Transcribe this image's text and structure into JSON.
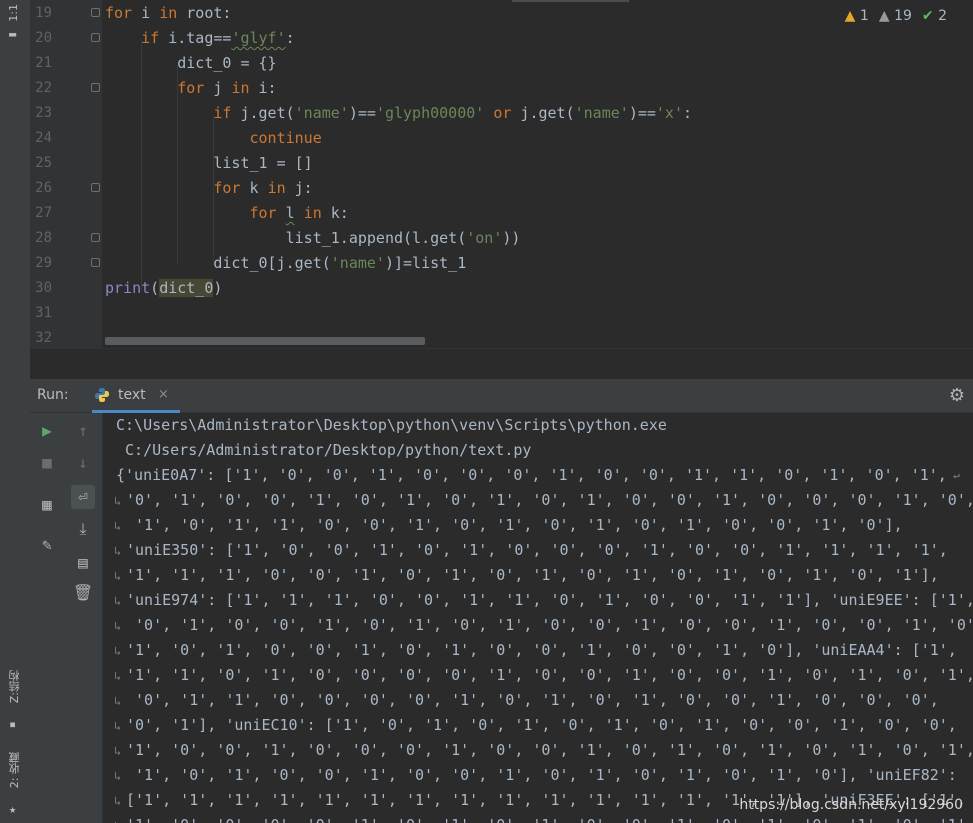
{
  "sidebar": {
    "top_label": "1:1",
    "structure_label": "Z:结构",
    "favorites_label": "2: 收藏"
  },
  "inspections": {
    "warnings": "1",
    "weak_warnings": "19",
    "typos": "2"
  },
  "editor": {
    "lines": [
      {
        "num": "19",
        "text": "for i in root:"
      },
      {
        "num": "20",
        "text": "    if i.tag=='glyf':"
      },
      {
        "num": "21",
        "text": "        dict_0 = {}"
      },
      {
        "num": "22",
        "text": "        for j in i:"
      },
      {
        "num": "23",
        "text": "            if j.get('name')=='glyph00000' or j.get('name')=='x':"
      },
      {
        "num": "24",
        "text": "                continue"
      },
      {
        "num": "25",
        "text": "            list_1 = []"
      },
      {
        "num": "26",
        "text": "            for k in j:"
      },
      {
        "num": "27",
        "text": "                for l in k:"
      },
      {
        "num": "28",
        "text": "                    list_1.append(l.get('on'))"
      },
      {
        "num": "29",
        "text": "            dict_0[j.get('name')]=list_1"
      },
      {
        "num": "30",
        "text": "print(dict_0)"
      },
      {
        "num": "31",
        "text": ""
      },
      {
        "num": "32",
        "text": ""
      }
    ]
  },
  "run": {
    "label": "Run:",
    "tab_label": "text",
    "tab_close": "×"
  },
  "console": {
    "lines": [
      "C:\\Users\\Administrator\\Desktop\\python\\venv\\Scripts\\python.exe",
      " C:/Users/Administrator/Desktop/python/text.py",
      "{'uniE0A7': ['1', '0', '0', '1', '0', '0', '0', '1', '0', '0', '1', '1', '0', '1', '0', '1',",
      "'0', '1', '0', '0', '1', '0', '1', '0', '1', '0', '1', '0', '0', '1', '0', '0', '0', '1', '0',",
      " '1', '0', '1', '1', '0', '0', '1', '0', '1', '0', '1', '0', '1', '0', '0', '1', '0'],",
      "'uniE350': ['1', '0', '0', '1', '0', '1', '0', '0', '0', '1', '0', '0', '1', '1', '1', '1',",
      "'1', '1', '1', '0', '0', '1', '0', '1', '0', '1', '0', '1', '0', '1', '0', '1', '0', '1'],",
      "'uniE974': ['1', '1', '1', '0', '0', '1', '1', '0', '1', '0', '0', '1', '1'], 'uniE9EE': ['1',",
      " '0', '1', '0', '0', '1', '0', '1', '0', '1', '0', '0', '1', '0', '0', '1', '0', '0', '1', '0',",
      "'1', '0', '1', '0', '0', '1', '0', '1', '0', '0', '1', '0', '0', '1', '0'], 'uniEAA4': ['1',",
      "'1', '1', '0', '1', '0', '0', '0', '0', '1', '0', '0', '1', '0', '0', '1', '0', '1', '0', '1',",
      " '0', '1', '1', '0', '0', '0', '0', '1', '0', '1', '0', '1', '0', '0', '1', '0', '0', '0',",
      "'0', '1'], 'uniEC10': ['1', '0', '1', '0', '1', '0', '1', '0', '1', '0', '0', '1', '0', '0',",
      "'1', '0', '0', '1', '0', '0', '0', '1', '0', '0', '1', '0', '1', '0', '1', '0', '1', '0', '1',",
      " '1', '0', '1', '0', '0', '1', '0', '0', '1', '0', '1', '0', '1', '0', '1', '0'], 'uniEF82':",
      "['1', '1', '1', '1', '1', '1', '1', '1', '1', '1', '1', '1', '1', '1', '1'], 'uniF3EE': ['1', '0',",
      "'1', '0', '0', '0', '0', '1', '0', '1', '0', '1', '0', '0', '1', '0', '1', '0', '1', '0', '1'"
    ]
  },
  "watermark": "https://blog.csdn.net/xyl192960"
}
